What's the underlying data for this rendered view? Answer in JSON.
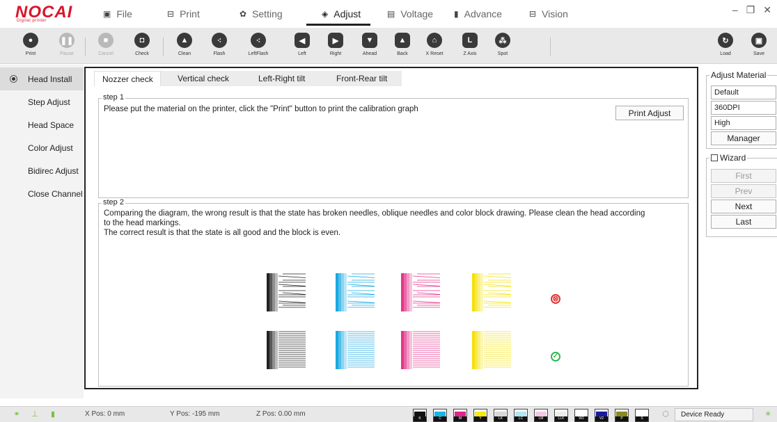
{
  "logo": {
    "brand": "NOCAI",
    "tagline": "Digital printer"
  },
  "menu": [
    {
      "label": "File",
      "icon": "file-icon",
      "glyph": "▣"
    },
    {
      "label": "Print",
      "icon": "print-icon",
      "glyph": "⊟"
    },
    {
      "label": "Setting",
      "icon": "gear-icon",
      "glyph": "✿"
    },
    {
      "label": "Adjust",
      "icon": "adjust-icon",
      "glyph": "◈"
    },
    {
      "label": "Voltage",
      "icon": "voltage-icon",
      "glyph": "▤"
    },
    {
      "label": "Advance",
      "icon": "advance-icon",
      "glyph": "▮"
    },
    {
      "label": "Vision",
      "icon": "vision-icon",
      "glyph": "⊟"
    }
  ],
  "active_menu": "Adjust",
  "window_controls": {
    "minimize": "–",
    "restore": "❐",
    "close": "✕"
  },
  "toolbar": {
    "print": "Print",
    "pause": "Pause",
    "cancel": "Cancel",
    "check": "Check",
    "clean": "Clean",
    "flash": "Flash",
    "leftflash": "LeftFlash",
    "left": "Left",
    "right": "Right",
    "ahead": "Ahead",
    "back": "Back",
    "xreset": "X Reset",
    "zaxis": "Z Axis",
    "spot": "Spot",
    "load": "Load",
    "save": "Save"
  },
  "sidebar": {
    "items": [
      {
        "label": "Head Install"
      },
      {
        "label": "Step Adjust"
      },
      {
        "label": "Head Space"
      },
      {
        "label": "Color Adjust"
      },
      {
        "label": "Bidirec Adjust"
      },
      {
        "label": "Close Channel"
      }
    ]
  },
  "tabs": [
    "Nozzer check",
    "Vertical check",
    "Left-Right tilt",
    "Front-Rear tilt"
  ],
  "step1": {
    "title": "step 1",
    "text": "Please put the material on the printer, click the \"Print\" button to print the calibration graph",
    "button": "Print Adjust"
  },
  "step2": {
    "title": "step 2",
    "line1": "Comparing the diagram, the wrong result is that the state has broken needles, oblique needles and color block drawing. Please clean the head according",
    "line2": "to the head markings.",
    "line3": "The correct result is that the state is all good and the block is even.",
    "pattern_colors": [
      "#222222",
      "#19a9e1",
      "#e6358b",
      "#f5e10a"
    ],
    "wrong_mark": "⊗",
    "right_mark": "✓"
  },
  "adjust_material": {
    "title": "Adjust Material",
    "fields": [
      "Default",
      "360DPI",
      "High"
    ],
    "manager": "Manager"
  },
  "wizard": {
    "title": "Wizard",
    "buttons": [
      "First",
      "Prev",
      "Next",
      "Last"
    ]
  },
  "status": {
    "x_pos": "X Pos: 0 mm",
    "y_pos": "Y Pos: -195 mm",
    "z_pos": "Z Pos: 0.00 mm",
    "device": "Device Ready",
    "inks": [
      {
        "label": "K",
        "color": "#111111"
      },
      {
        "label": "C",
        "color": "#19b5e6"
      },
      {
        "label": "M",
        "color": "#e0238a"
      },
      {
        "label": "Y",
        "color": "#f5ea12"
      },
      {
        "label": "LK",
        "color": "#d8d8d8"
      },
      {
        "label": "LC",
        "color": "#aee8f3"
      },
      {
        "label": "LM",
        "color": "#f3c8e4"
      },
      {
        "label": "LLK",
        "color": "#eeeeee"
      },
      {
        "label": "W2",
        "color": "#ffffff"
      },
      {
        "label": "V2",
        "color": "#1a1aa0"
      },
      {
        "label": "P",
        "color": "#8a8a22"
      },
      {
        "label": "S",
        "color": "#ffffff"
      }
    ]
  }
}
